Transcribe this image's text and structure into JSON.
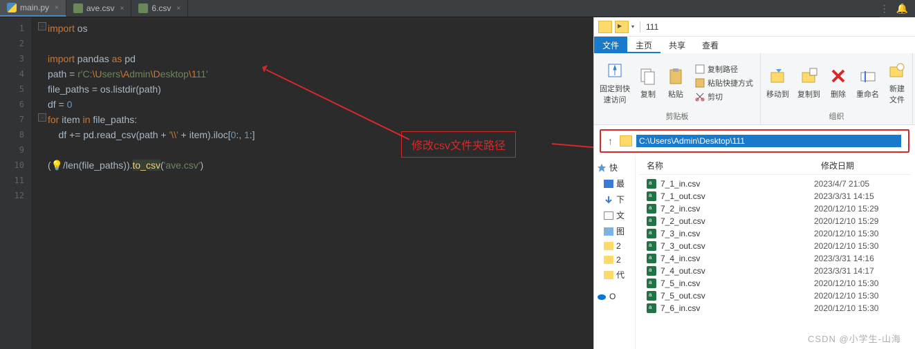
{
  "tabs": [
    {
      "label": "main.py",
      "type": "py"
    },
    {
      "label": "ave.csv",
      "type": "csv"
    },
    {
      "label": "6.csv",
      "type": "csv"
    }
  ],
  "code_lines": [
    "1",
    "2",
    "3",
    "4",
    "5",
    "6",
    "7",
    "8",
    "9",
    "10",
    "11",
    "12"
  ],
  "code": {
    "l1a": "import",
    "l1b": " os",
    "l3a": "import",
    "l3b": " pandas ",
    "l3c": "as",
    "l3d": " pd",
    "l4a": "path = ",
    "l4b": "r'C:",
    "l4c": "\\U",
    "l4d": "sers",
    "l4e": "\\A",
    "l4f": "dmin",
    "l4g": "\\D",
    "l4h": "esktop",
    "l4i": "\\1",
    "l4j": "11'",
    "l5a": "file_paths = os.listdir(path)",
    "l6a": "df = ",
    "l6b": "0",
    "l7a": "for ",
    "l7b": "item ",
    "l7c": "in ",
    "l7d": "file_paths:",
    "l8a": "    df += pd.read_csv(path + ",
    "l8b": "'",
    "l8c": "\\\\",
    "l8d": "'",
    "l8e": " + item).iloc[",
    "l8f": "0",
    "l8g": ":",
    "l8h": ", ",
    "l8i": "1",
    "l8j": ":]",
    "l10a": "(",
    "l10bulb": "💡",
    "l10b": "/",
    "l10c": "len",
    "l10d": "(file_paths)).",
    "l10e": "to_csv",
    "l10f": "(",
    "l10g": "'ave.csv'",
    "l10h": ")"
  },
  "annotation": "修改csv文件夹路径",
  "explorer": {
    "title_path": "111",
    "menu": {
      "file": "文件",
      "home": "主页",
      "share": "共享",
      "view": "查看"
    },
    "ribbon": {
      "pin": "固定到快\n速访问",
      "copy": "复制",
      "paste": "粘贴",
      "copypath": "复制路径",
      "pasteshortcut": "粘贴快捷方式",
      "cut": "剪切",
      "clipboard": "剪贴板",
      "moveto": "移动到",
      "copyto": "复制到",
      "delete": "删除",
      "rename": "重命名",
      "new": "新建\n文件",
      "organize": "组织"
    },
    "address": "C:\\Users\\Admin\\Desktop\\111",
    "sidebar": {
      "quick": "快",
      "recent": "最",
      "down": "下",
      "doc": "文",
      "pic": "图",
      "f1": "2",
      "f2": "2",
      "f3": "代",
      "od": "O"
    },
    "columns": {
      "name": "名称",
      "date": "修改日期"
    },
    "files": [
      {
        "name": "7_1_in.csv",
        "date": "2023/4/7 21:05"
      },
      {
        "name": "7_1_out.csv",
        "date": "2023/3/31 14:15"
      },
      {
        "name": "7_2_in.csv",
        "date": "2020/12/10 15:29"
      },
      {
        "name": "7_2_out.csv",
        "date": "2020/12/10 15:29"
      },
      {
        "name": "7_3_in.csv",
        "date": "2020/12/10 15:30"
      },
      {
        "name": "7_3_out.csv",
        "date": "2020/12/10 15:30"
      },
      {
        "name": "7_4_in.csv",
        "date": "2023/3/31 14:16"
      },
      {
        "name": "7_4_out.csv",
        "date": "2023/3/31 14:17"
      },
      {
        "name": "7_5_in.csv",
        "date": "2020/12/10 15:30"
      },
      {
        "name": "7_5_out.csv",
        "date": "2020/12/10 15:30"
      },
      {
        "name": "7_6_in.csv",
        "date": "2020/12/10 15:30"
      }
    ]
  },
  "watermark": "CSDN @小学生-山海"
}
